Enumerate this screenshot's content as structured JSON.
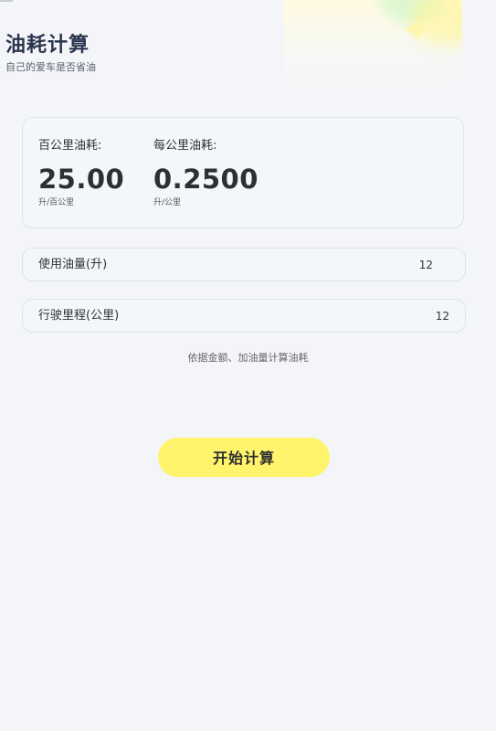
{
  "header": {
    "title": "油耗计算",
    "subtitle": "自己的爱车是否省油"
  },
  "result": {
    "per100": {
      "label": "百公里油耗:",
      "value": "25.00",
      "unit": "升/百公里"
    },
    "perKm": {
      "label": "每公里油耗:",
      "value": "0.2500",
      "unit": "升/公里"
    }
  },
  "inputs": {
    "fuel": {
      "label": "使用油量(升)",
      "value": "12"
    },
    "distance": {
      "label": "行驶里程(公里)",
      "value": "12"
    }
  },
  "hint_link": "依据金额、加油量计算油耗",
  "start_button": "开始计算",
  "colors": {
    "background": "#f4f5f8",
    "card_background": "#f2f7fc",
    "accent_button": "#fff46b",
    "title": "#2c3550"
  },
  "icons": {
    "decoration": "sparkle-icon"
  }
}
